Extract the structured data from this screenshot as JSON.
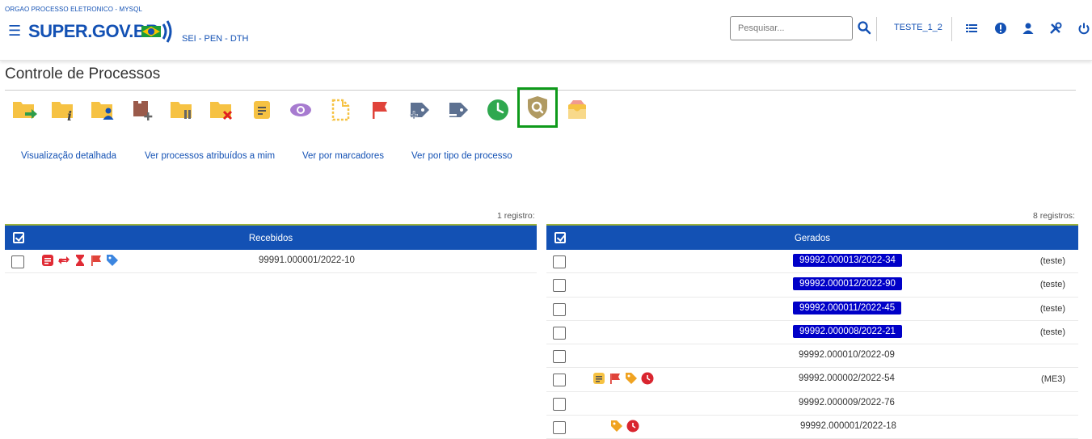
{
  "header": {
    "org": "ORGAO PROCESSO ELETRONICO - MYSQL",
    "brand": "SUPER.GOV.BR",
    "subsystem": "SEI - PEN - DTH",
    "search_placeholder": "Pesquisar...",
    "user": "TESTE_1_2"
  },
  "page": {
    "title": "Controle de Processos"
  },
  "toolbar": {
    "selected": "acompanhamento-especial-button",
    "icons": [
      "folder-forward-icon",
      "folder-info-icon",
      "folder-user-icon",
      "folder-add-icon",
      "folder-pause-icon",
      "folder-close-icon",
      "note-icon",
      "eye-icon",
      "document-dashed-icon",
      "flag-icon",
      "tag-add-icon",
      "tag-remove-icon",
      "clock-icon",
      "shield-search-icon",
      "inbox-icon"
    ]
  },
  "view_links": {
    "detailed": "Visualização detalhada",
    "assigned": "Ver processos atribuídos a mim",
    "markers": "Ver por marcadores",
    "type": "Ver por tipo de processo"
  },
  "received": {
    "count_label": "1 registro:",
    "header": "Recebidos",
    "rows": [
      {
        "number": "99991.000001/2022-10",
        "icons": [
          "document-red-icon",
          "transfer-icon",
          "hourglass-icon",
          "flag-icon",
          "tag-blue-icon"
        ]
      }
    ]
  },
  "generated": {
    "count_label": "8 registros:",
    "header": "Gerados",
    "rows": [
      {
        "number": "99992.000013/2022-34",
        "highlighted": true,
        "note": "(teste)"
      },
      {
        "number": "99992.000012/2022-90",
        "highlighted": true,
        "note": "(teste)"
      },
      {
        "number": "99992.000011/2022-45",
        "highlighted": true,
        "note": "(teste)"
      },
      {
        "number": "99992.000008/2022-21",
        "highlighted": true,
        "note": "(teste)"
      },
      {
        "number": "99992.000010/2022-09",
        "highlighted": false,
        "note": ""
      },
      {
        "number": "99992.000002/2022-54",
        "highlighted": false,
        "note": "(ME3)"
      },
      {
        "number": "99992.000009/2022-76",
        "highlighted": false,
        "note": ""
      },
      {
        "number": "99992.000001/2022-18",
        "highlighted": false,
        "note": ""
      }
    ]
  },
  "colors": {
    "primary": "#1351b4",
    "table_header": "#1351b4",
    "highlight": "#0000c8",
    "selected_outline": "#0e9a1a"
  }
}
